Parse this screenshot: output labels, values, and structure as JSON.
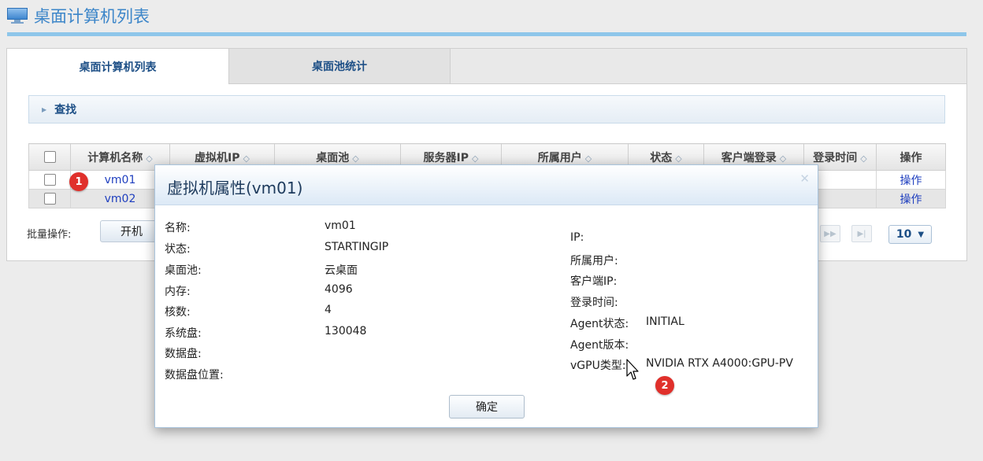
{
  "page": {
    "title": "桌面计算机列表"
  },
  "tabs": [
    {
      "label": "桌面计算机列表",
      "active": true
    },
    {
      "label": "桌面池统计",
      "active": false
    }
  ],
  "search": {
    "label": "查找"
  },
  "table": {
    "columns": [
      "计算机名称",
      "虚拟机IP",
      "桌面池",
      "服务器IP",
      "所属用户",
      "状态",
      "客户端登录",
      "登录时间",
      "操作"
    ],
    "rows": [
      {
        "name": "vm01",
        "action": "操作"
      },
      {
        "name": "vm02",
        "action": "操作"
      }
    ]
  },
  "batch": {
    "label": "批量操作:",
    "button": "开机"
  },
  "pager": {
    "page_size": "10"
  },
  "markers": [
    "1",
    "2"
  ],
  "dialog": {
    "title": "虚拟机属性(vm01)",
    "left": [
      {
        "label": "名称:",
        "value": "vm01"
      },
      {
        "label": "状态:",
        "value": "STARTINGIP"
      },
      {
        "label": "桌面池:",
        "value": "云桌面"
      },
      {
        "label": "内存:",
        "value": "4096"
      },
      {
        "label": "核数:",
        "value": "4"
      },
      {
        "label": "系统盘:",
        "value": "130048"
      },
      {
        "label": "数据盘:",
        "value": ""
      },
      {
        "label": "数据盘位置:",
        "value": ""
      }
    ],
    "right": [
      {
        "label": "IP:",
        "value": ""
      },
      {
        "label": "所属用户:",
        "value": ""
      },
      {
        "label": "客户端IP:",
        "value": ""
      },
      {
        "label": "登录时间:",
        "value": ""
      },
      {
        "label": "Agent状态:",
        "value": "INITIAL"
      },
      {
        "label": "Agent版本:",
        "value": ""
      },
      {
        "label": "vGPU类型:",
        "value": "NVIDIA RTX A4000:GPU-PV"
      }
    ],
    "confirm": "确定"
  },
  "colors": {
    "accent": "#3d86c9",
    "link": "#1f3fbf",
    "marker": "#e0302b"
  }
}
